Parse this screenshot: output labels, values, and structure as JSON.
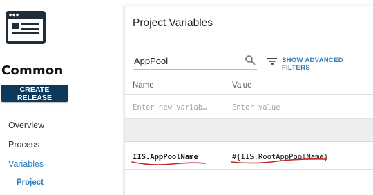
{
  "sidebar": {
    "logo_icon": "project-dashboard-icon",
    "project_name": "Common",
    "create_release_label": "CREATE RELEASE",
    "nav": [
      {
        "label": "Overview",
        "active": false
      },
      {
        "label": "Process",
        "active": false
      },
      {
        "label": "Variables",
        "active": true
      },
      {
        "label": "Project",
        "active": true,
        "sub": true
      }
    ]
  },
  "main": {
    "title": "Project Variables",
    "search": {
      "value": "AppPool",
      "icon": "search-icon"
    },
    "advanced_filters_label": "SHOW ADVANCED FILTERS",
    "advanced_filters_icon": "filter-icon",
    "columns": {
      "name": "Name",
      "value": "Value"
    },
    "new_row": {
      "name_placeholder": "Enter new variab…",
      "value_placeholder": "Enter value"
    },
    "variables": [
      {
        "name": "IIS.AppPoolName",
        "value": "#{IIS.RootAppPoolName}"
      }
    ]
  },
  "colors": {
    "primary_button": "#0d3a5c",
    "accent": "#2a7fc0",
    "annotation": "#c0282d"
  }
}
